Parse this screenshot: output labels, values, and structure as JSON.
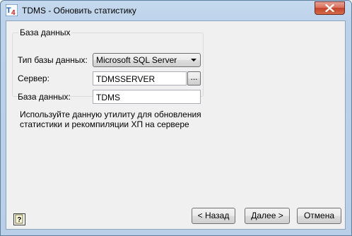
{
  "window": {
    "title": "TDMS - Обновить статистику",
    "app_icon": "tdms-app-icon",
    "close_icon": "close-icon"
  },
  "group": {
    "legend": "База данных",
    "db_type_label": "Тип базы данных:",
    "db_type_value": "Microsoft SQL Server",
    "server_label": "Сервер:",
    "server_value": "TDMSSERVER",
    "browse_label": "...",
    "database_label": "База данных:",
    "database_value": "TDMS"
  },
  "description": {
    "line1": "Используйте данную утилиту для обновления",
    "line2": "статистики и рекомпиляции ХП на сервере"
  },
  "buttons": {
    "help_icon": "help-icon",
    "back": "< Назад",
    "next": "Далее >",
    "cancel": "Отмена"
  },
  "colors": {
    "accent_close": "#c2432c",
    "app_icon_blue": "#1a5fb4",
    "app_icon_red": "#d01c1c"
  }
}
